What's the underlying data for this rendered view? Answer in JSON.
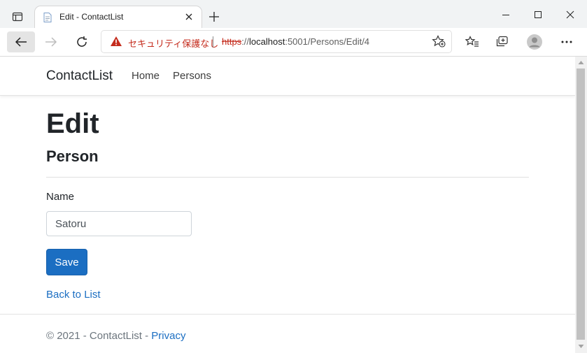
{
  "browser": {
    "tab_title": "Edit - ContactList",
    "security_warning": "セキュリティ保護なし",
    "url_scheme": "https",
    "url_sep": "://",
    "url_host": "localhost",
    "url_path": ":5001/Persons/Edit/4",
    "icons": [
      "tab-actions-icon",
      "page-favicon-icon",
      "close-icon",
      "plus-icon",
      "minimize-icon",
      "maximize-icon",
      "close-window-icon",
      "back-arrow-icon",
      "forward-arrow-icon",
      "refresh-icon",
      "warning-icon",
      "add-favorite-icon",
      "favorites-icon",
      "collections-icon",
      "profile-icon",
      "more-icon"
    ]
  },
  "navbar": {
    "brand": "ContactList",
    "links": [
      "Home",
      "Persons"
    ]
  },
  "main": {
    "title": "Edit",
    "subtitle": "Person",
    "name_label": "Name",
    "name_value": "Satoru",
    "save_label": "Save",
    "back_link": "Back to List"
  },
  "footer": {
    "copyright": "© 2021 - ContactList - ",
    "privacy": "Privacy"
  },
  "colors": {
    "primary": "#1b6ec2",
    "warning": "#c42b1c"
  }
}
